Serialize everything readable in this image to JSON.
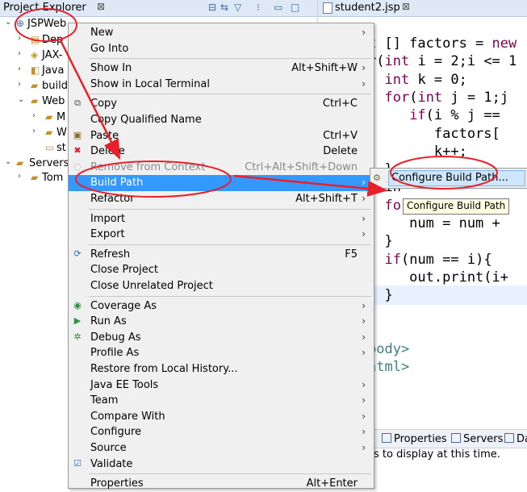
{
  "project_explorer": {
    "title": "Project Explorer",
    "close_glyph": "⊠",
    "toolbar_icons": [
      "collapse-all-icon",
      "link-with-editor-icon",
      "filter-icon",
      "view-menu-icon",
      "minimize-icon",
      "maximize-icon"
    ],
    "tree": [
      {
        "label": "JSPWeb",
        "icon": "web-project-icon",
        "expanded": true
      },
      {
        "label": "Dep",
        "icon": "deployment-descriptor-icon",
        "expanded": false
      },
      {
        "label": "JAX-",
        "icon": "jax-ws-icon",
        "expanded": false
      },
      {
        "label": "Java",
        "icon": "java-resources-icon",
        "expanded": false
      },
      {
        "label": "build",
        "icon": "folder-icon",
        "expanded": false
      },
      {
        "label": "Web",
        "icon": "folder-icon",
        "expanded": true
      },
      {
        "label": "M",
        "icon": "folder-icon",
        "expanded": false
      },
      {
        "label": "W",
        "icon": "folder-icon",
        "expanded": false
      },
      {
        "label": "st",
        "icon": "jsp-file-icon",
        "expanded": false
      },
      {
        "label": "Servers",
        "icon": "folder-icon",
        "expanded": true
      },
      {
        "label": "Tom",
        "icon": "folder-icon",
        "expanded": false
      }
    ]
  },
  "editor": {
    "tab_title": "student2.jsp",
    "close_glyph": "⊠",
    "code": [
      "t [] factors = new",
      "r(int i = 2;i <= 1",
      "  int k = 0;",
      "  for(int j = 1;j",
      "     if(i % j ==",
      "        factors[",
      "        k++;",
      "  }",
      "  in",
      "  for(int j = 0;j",
      "     num = num +",
      "  }",
      "  if(num == i){",
      "     out.print(i+",
      "  }",
      "",
      "",
      "body>",
      "html>"
    ]
  },
  "bottom_panel": {
    "tabs": [
      "s",
      "Properties",
      "Servers",
      "Da"
    ],
    "message": "es to display at this time."
  },
  "context_menu": {
    "items": [
      {
        "label": "New",
        "accel": "",
        "submenu": true,
        "icon": "",
        "disabled": false,
        "selected": false
      },
      {
        "label": "Go Into",
        "accel": "",
        "submenu": false,
        "icon": "",
        "disabled": false,
        "selected": false
      },
      {
        "sep": true
      },
      {
        "label": "Show In",
        "accel": "Alt+Shift+W",
        "submenu": true,
        "icon": "",
        "disabled": false,
        "selected": false
      },
      {
        "label": "Show in Local Terminal",
        "accel": "",
        "submenu": true,
        "icon": "",
        "disabled": false,
        "selected": false
      },
      {
        "sep": true
      },
      {
        "label": "Copy",
        "accel": "Ctrl+C",
        "submenu": false,
        "icon": "copy-icon",
        "disabled": false,
        "selected": false
      },
      {
        "label": "Copy Qualified Name",
        "accel": "",
        "submenu": false,
        "icon": "",
        "disabled": false,
        "selected": false
      },
      {
        "label": "Paste",
        "accel": "Ctrl+V",
        "submenu": false,
        "icon": "paste-icon",
        "disabled": false,
        "selected": false
      },
      {
        "label": "Delete",
        "accel": "Delete",
        "submenu": false,
        "icon": "delete-icon",
        "disabled": false,
        "selected": false
      },
      {
        "label": "Remove from Context",
        "accel": "Ctrl+Alt+Shift+Down",
        "submenu": false,
        "icon": "remove-context-icon",
        "disabled": true,
        "selected": false
      },
      {
        "label": "Build Path",
        "accel": "",
        "submenu": true,
        "icon": "",
        "disabled": false,
        "selected": true
      },
      {
        "label": "Refactor",
        "accel": "Alt+Shift+T",
        "submenu": true,
        "icon": "",
        "disabled": false,
        "selected": false
      },
      {
        "sep": true
      },
      {
        "label": "Import",
        "accel": "",
        "submenu": true,
        "icon": "",
        "disabled": false,
        "selected": false
      },
      {
        "label": "Export",
        "accel": "",
        "submenu": true,
        "icon": "",
        "disabled": false,
        "selected": false
      },
      {
        "sep": true
      },
      {
        "label": "Refresh",
        "accel": "F5",
        "submenu": false,
        "icon": "refresh-icon",
        "disabled": false,
        "selected": false
      },
      {
        "label": "Close Project",
        "accel": "",
        "submenu": false,
        "icon": "",
        "disabled": false,
        "selected": false
      },
      {
        "label": "Close Unrelated Project",
        "accel": "",
        "submenu": false,
        "icon": "",
        "disabled": false,
        "selected": false
      },
      {
        "sep": true
      },
      {
        "label": "Coverage As",
        "accel": "",
        "submenu": true,
        "icon": "coverage-icon",
        "disabled": false,
        "selected": false
      },
      {
        "label": "Run As",
        "accel": "",
        "submenu": true,
        "icon": "run-icon",
        "disabled": false,
        "selected": false
      },
      {
        "label": "Debug As",
        "accel": "",
        "submenu": true,
        "icon": "debug-icon",
        "disabled": false,
        "selected": false
      },
      {
        "label": "Profile As",
        "accel": "",
        "submenu": true,
        "icon": "",
        "disabled": false,
        "selected": false
      },
      {
        "label": "Restore from Local History...",
        "accel": "",
        "submenu": false,
        "icon": "",
        "disabled": false,
        "selected": false
      },
      {
        "label": "Java EE Tools",
        "accel": "",
        "submenu": true,
        "icon": "",
        "disabled": false,
        "selected": false
      },
      {
        "label": "Team",
        "accel": "",
        "submenu": true,
        "icon": "",
        "disabled": false,
        "selected": false
      },
      {
        "label": "Compare With",
        "accel": "",
        "submenu": true,
        "icon": "",
        "disabled": false,
        "selected": false
      },
      {
        "label": "Configure",
        "accel": "",
        "submenu": true,
        "icon": "",
        "disabled": false,
        "selected": false
      },
      {
        "label": "Source",
        "accel": "",
        "submenu": true,
        "icon": "",
        "disabled": false,
        "selected": false
      },
      {
        "label": "Validate",
        "accel": "",
        "submenu": false,
        "icon": "validate-checkbox-icon",
        "disabled": false,
        "selected": false
      },
      {
        "sep": true
      },
      {
        "label": "Properties",
        "accel": "Alt+Enter",
        "submenu": false,
        "icon": "",
        "disabled": false,
        "selected": false
      }
    ]
  },
  "submenu": {
    "item": "Configure Build Path...",
    "icon": "configure-build-path-icon",
    "tooltip": "Configure Build Path"
  },
  "annotation_color": "#e8202a"
}
